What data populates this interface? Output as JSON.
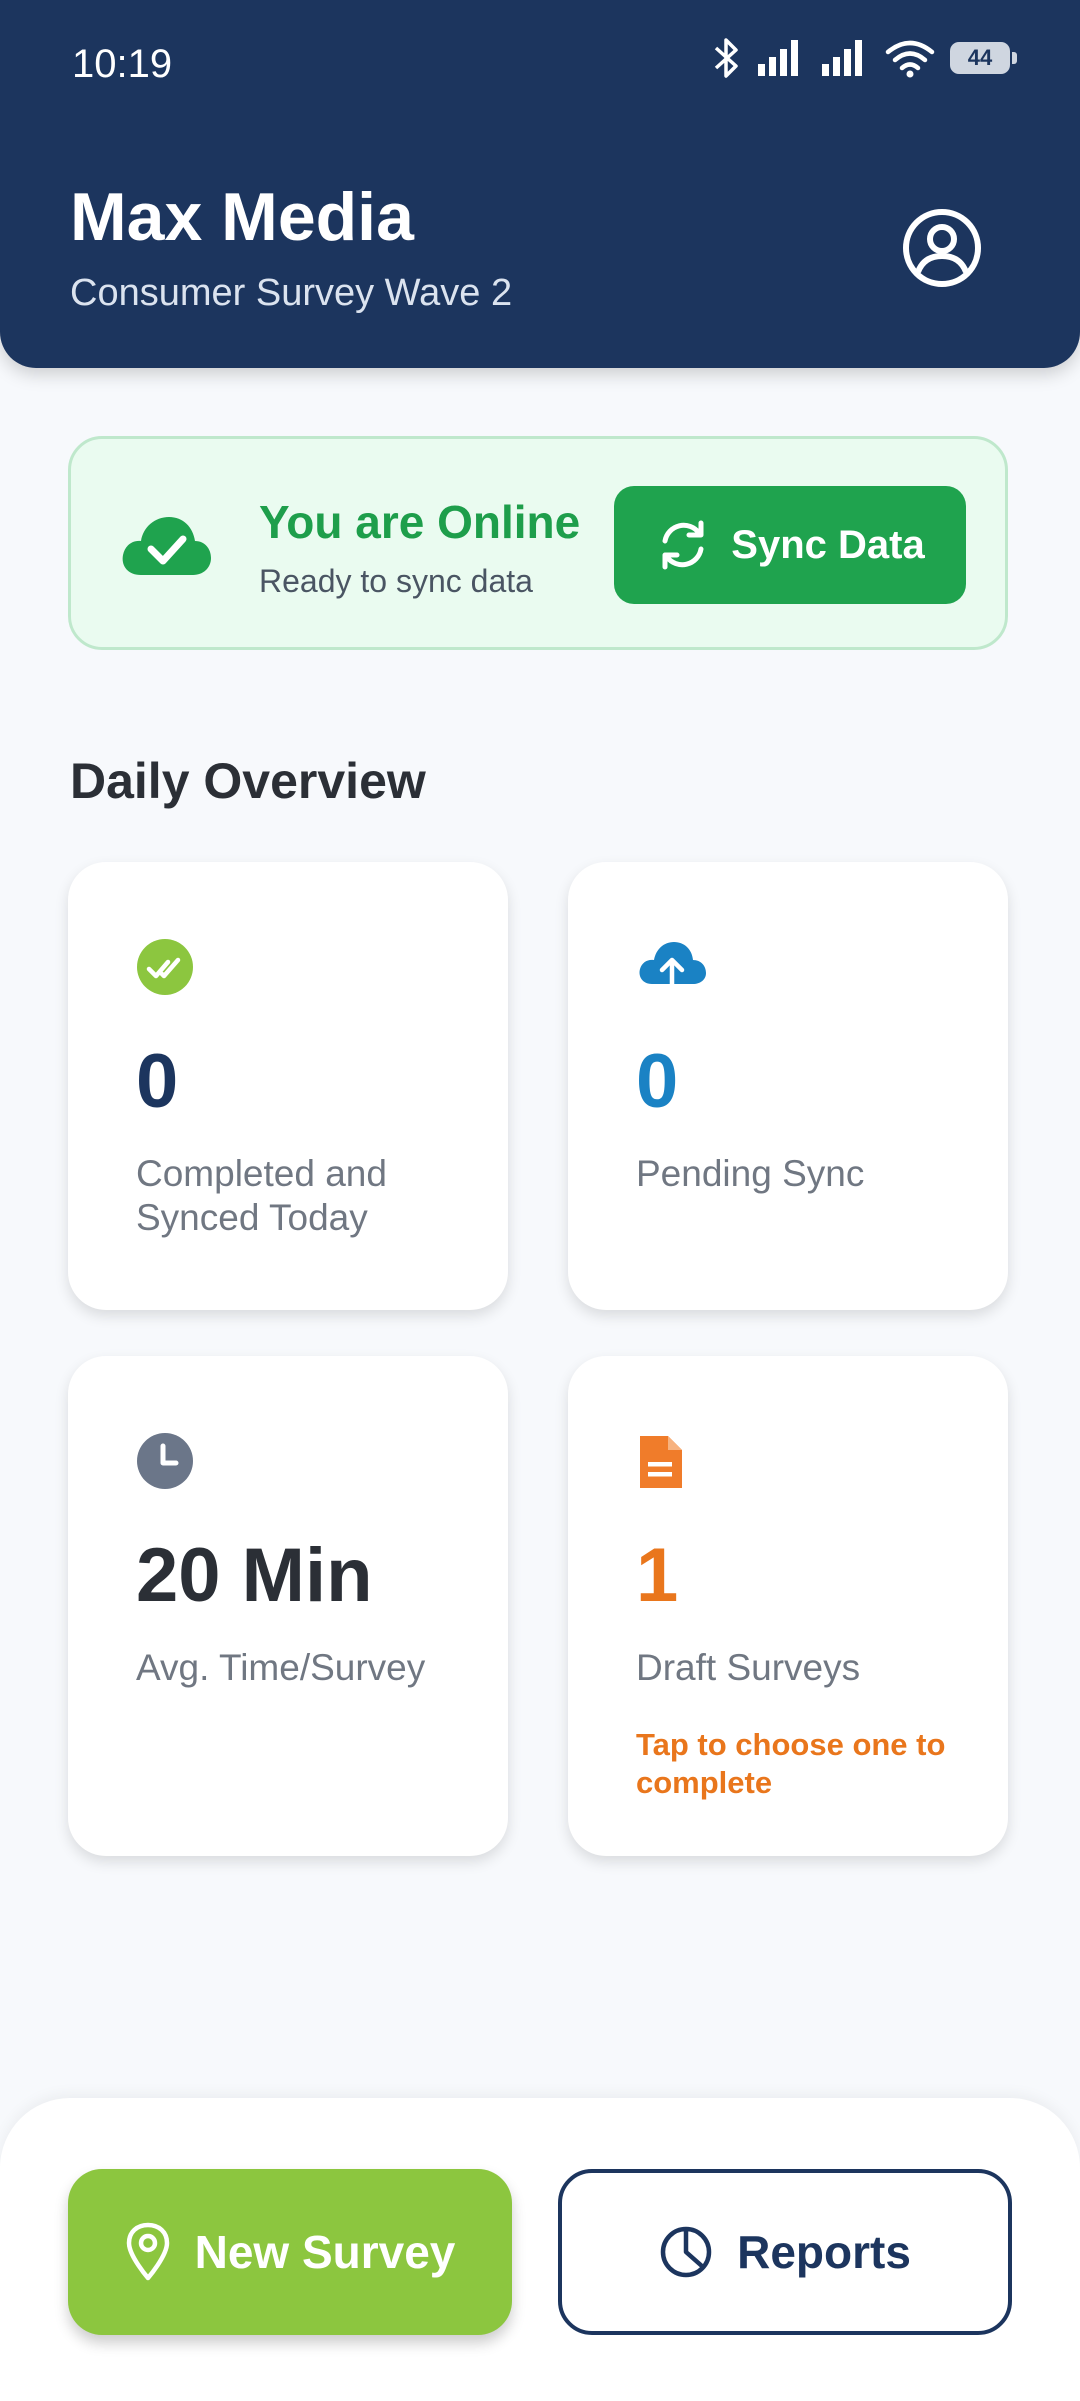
{
  "status_bar": {
    "time": "10:19",
    "battery": "44"
  },
  "header": {
    "title": "Max Media",
    "subtitle": "Consumer Survey Wave 2"
  },
  "connection": {
    "title": "You are Online",
    "subtitle": "Ready to sync data",
    "sync_label": "Sync Data"
  },
  "overview": {
    "title": "Daily Overview",
    "cards": [
      {
        "value": "0",
        "label": "Completed and Synced Today",
        "icon": "check-double-icon",
        "color": "#1c355e"
      },
      {
        "value": "0",
        "label": "Pending Sync",
        "icon": "cloud-upload-icon",
        "color": "#1a82c4"
      },
      {
        "value": "20 Min",
        "label": "Avg. Time/Survey",
        "icon": "clock-icon",
        "color": "#2b2f36"
      },
      {
        "value": "1",
        "label": "Draft Surveys",
        "hint": "Tap to choose one to complete",
        "icon": "document-icon",
        "color": "#e9761c"
      }
    ]
  },
  "actions": {
    "new_survey": "New Survey",
    "reports": "Reports"
  },
  "colors": {
    "header_bg": "#1c355e",
    "online_green": "#1fa34e",
    "accent_lime": "#8cc63f",
    "accent_orange": "#e9761c",
    "accent_blue": "#1a82c4"
  }
}
